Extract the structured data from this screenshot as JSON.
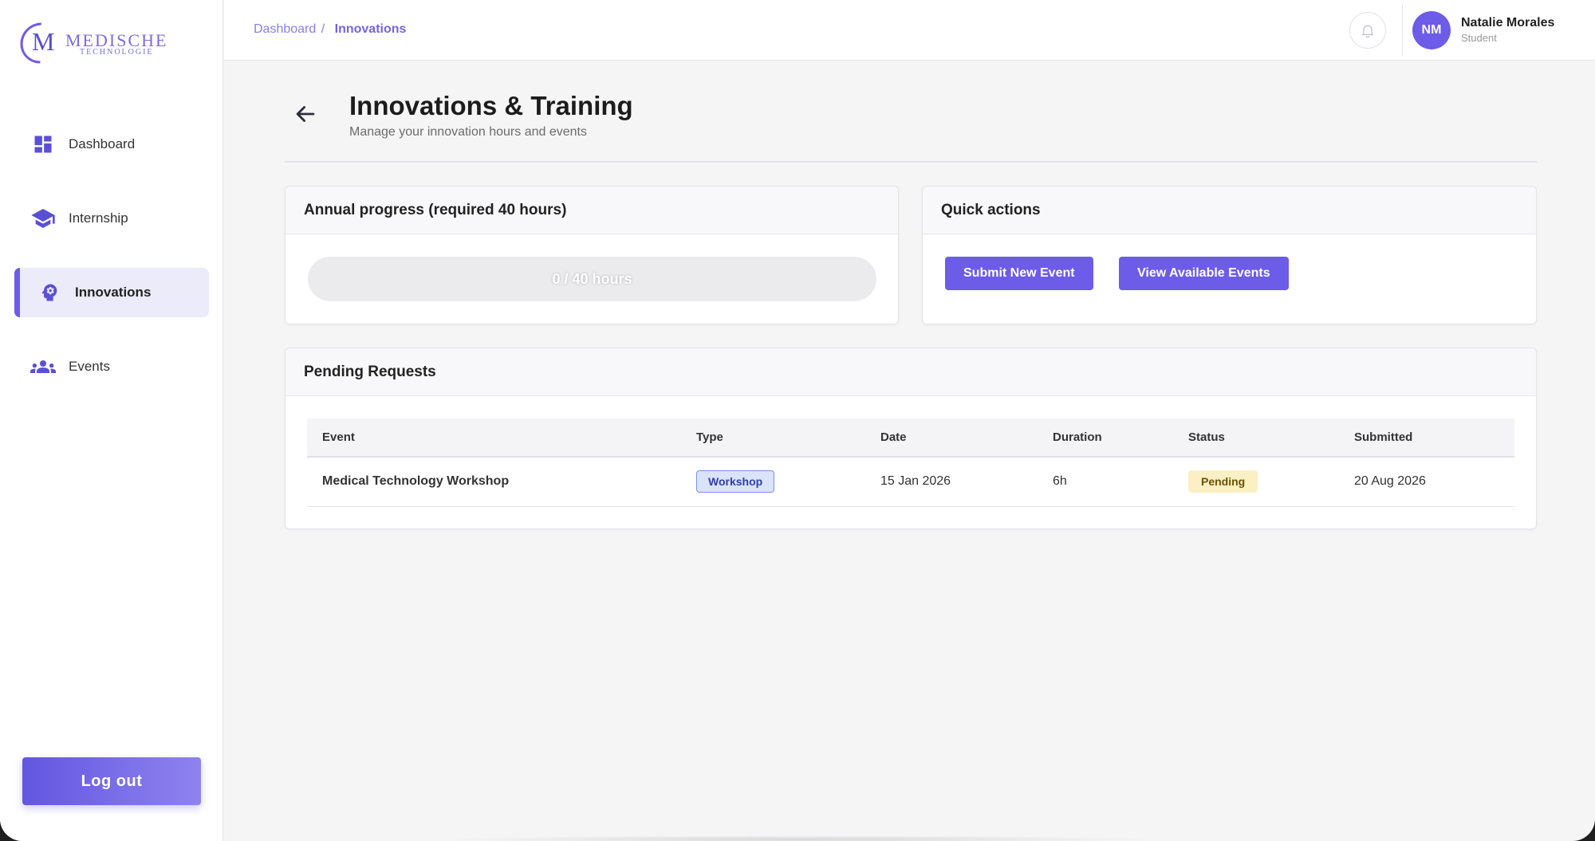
{
  "brand": {
    "logo_letter": "M",
    "logo_word": "MEDISCHE",
    "logo_sub": "TECHNOLOGIE",
    "accent": "#6c5ce7"
  },
  "sidebar": {
    "items": [
      {
        "label": "Dashboard",
        "icon": "dashboard-icon",
        "active": false
      },
      {
        "label": "Internship",
        "icon": "graduation-cap-icon",
        "active": false
      },
      {
        "label": "Innovations",
        "icon": "innovation-head-icon",
        "active": true
      },
      {
        "label": "Events",
        "icon": "people-group-icon",
        "active": false
      }
    ],
    "logout_label": "Log out"
  },
  "topbar": {
    "breadcrumb": {
      "parent": "Dashboard",
      "separator": "/",
      "current": "Innovations"
    },
    "bell_icon": "bell-icon",
    "user": {
      "initials": "NM",
      "name": "Natalie Morales",
      "role": "Student"
    }
  },
  "page": {
    "title": "Innovations & Training",
    "subtitle": "Manage your innovation hours and events",
    "back_icon": "arrow-left-icon"
  },
  "progress_card": {
    "title": "Annual progress (required 40 hours)",
    "text": "0 / 40 hours",
    "value": 0,
    "max": 40
  },
  "quick_actions": {
    "title": "Quick actions",
    "submit_label": "Submit New Event",
    "view_label": "View Available Events"
  },
  "pending": {
    "title": "Pending Requests",
    "columns": [
      "Event",
      "Type",
      "Date",
      "Duration",
      "Status",
      "Submitted"
    ],
    "rows": [
      {
        "event": "Medical Technology Workshop",
        "type": "Workshop",
        "date": "15 Jan 2026",
        "duration": "6h",
        "status": "Pending",
        "submitted": "20 Aug 2026"
      }
    ]
  }
}
